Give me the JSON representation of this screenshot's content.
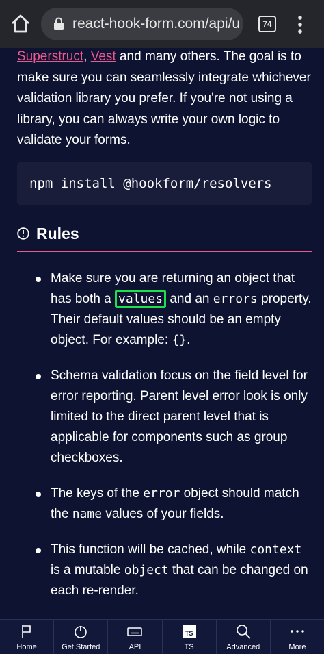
{
  "browser": {
    "url": "react-hook-form.com/api/u",
    "tab_count": "74"
  },
  "intro": {
    "link1": "Superstruct",
    "sep": ", ",
    "link2": "Vest",
    "text": " and many others. The goal is to make sure you can seamlessly integrate whichever validation library you prefer. If you're not using a library, you can always write your own logic to validate your forms."
  },
  "code": "npm install @hookform/resolvers",
  "rules": {
    "title": "Rules",
    "items": [
      {
        "a": "Make sure you are returning an object that has both a ",
        "code1": "values",
        "b": " and an ",
        "code2": "errors",
        "c": " property. Their default values should be an empty object. For example: ",
        "code3": "{}",
        "d": "."
      },
      {
        "text": "Schema validation focus on the field level for error reporting. Parent level error look is only limited to the direct parent level that is applicable for components such as group checkboxes."
      },
      {
        "a": "The keys of the ",
        "code1": "error",
        "b": " object should match the ",
        "code2": "name",
        "c": " values of your fields."
      },
      {
        "a": "This function will be cached, while ",
        "code1": "context",
        "b": " is a mutable ",
        "code2": "object",
        "c": " that can be changed on each re-render."
      }
    ]
  },
  "nav": {
    "items": [
      {
        "label": "Home",
        "icon": "flag-icon"
      },
      {
        "label": "Get Started",
        "icon": "power-icon"
      },
      {
        "label": "API",
        "icon": "keyboard-icon"
      },
      {
        "label": "TS",
        "icon": "ts-icon",
        "badge": "TS"
      },
      {
        "label": "Advanced",
        "icon": "search-icon"
      },
      {
        "label": "More",
        "icon": "more-icon"
      }
    ]
  },
  "colors": {
    "background": "#0d1330",
    "accent": "#ec5990",
    "highlight": "#1ee04e",
    "code_bg": "#191d3a"
  }
}
